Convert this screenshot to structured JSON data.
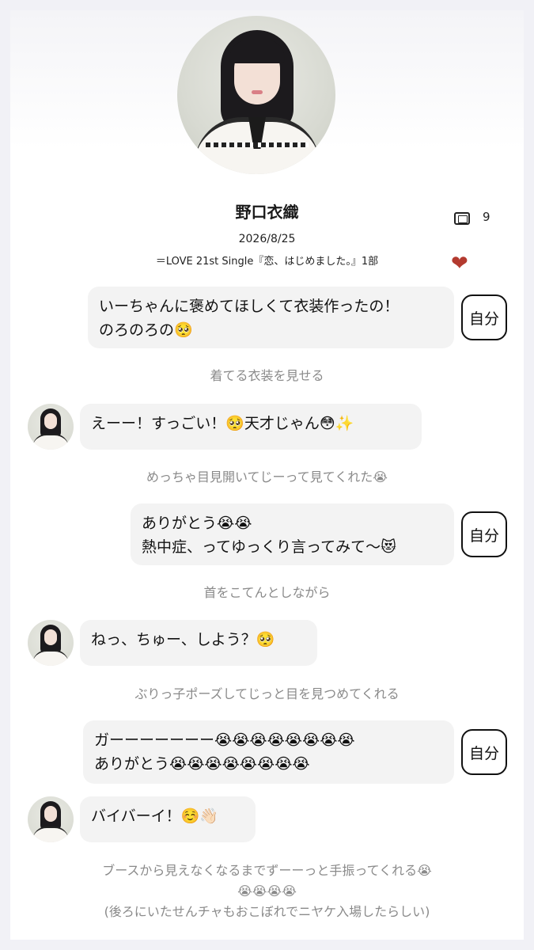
{
  "profile": {
    "name": "野口衣織",
    "date": "2026/8/25",
    "event": "＝LOVE 21st Single『恋、はじめました。』1部",
    "film_icon": "film-icon",
    "film_count": "9",
    "heart_icon": "heart-icon",
    "heart_color": "#b33a2f"
  },
  "messages": [
    {
      "from": "self",
      "text": "いーちゃんに褒めてほしくて衣装作ったの！\nのろのろの🥺"
    },
    {
      "from": "note",
      "text": "着てる衣装を見せる"
    },
    {
      "from": "idol",
      "text": "えーー！すっごい！🥺天才じゃん😳✨"
    },
    {
      "from": "note",
      "text": "めっちゃ目見開いてじーって見てくれた😭"
    },
    {
      "from": "self",
      "text": "ありがとう😭😭\n熱中症、ってゆっくり言ってみて〜😻"
    },
    {
      "from": "note",
      "text": "首をこてんとしながら"
    },
    {
      "from": "idol",
      "text": "ねっ、ちゅー、しよう？🥺"
    },
    {
      "from": "note",
      "text": "ぶりっ子ポーズしてじっと目を見つめてくれる"
    },
    {
      "from": "self",
      "text": "ガーーーーーーー😭😭😭😭😭😭😭😭\nありがとう😭😭😭😭😭😭😭😭"
    },
    {
      "from": "idol",
      "text": "バイバーイ！☺️👋🏻"
    },
    {
      "from": "note",
      "text": "ブースから見えなくなるまでずーーっと手振ってくれる😭\n😭😭😭😭\n(後ろにいたせんチャもおこぼれでニヤケ入場したらしい)"
    }
  ],
  "self_label": "自分"
}
